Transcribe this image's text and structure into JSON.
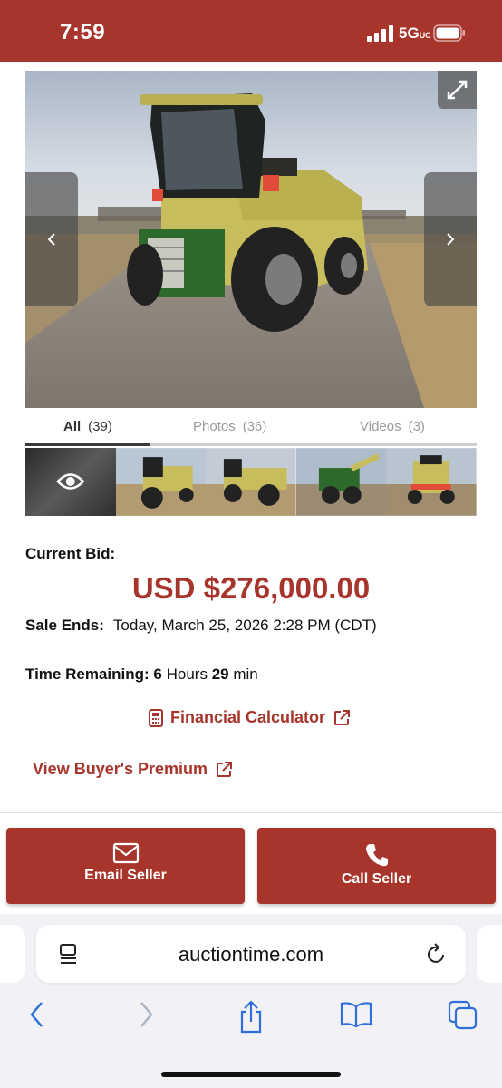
{
  "status_bar": {
    "time": "7:59",
    "network": "5G",
    "network_suffix": "UC"
  },
  "gallery": {
    "main_image": "forage-harvester-photo",
    "tabs": [
      {
        "label": "All",
        "count": "(39)",
        "active": true
      },
      {
        "label": "Photos",
        "count": "(36)",
        "active": false
      },
      {
        "label": "Videos",
        "count": "(3)",
        "active": false
      }
    ],
    "thumbnails": [
      "video-thumbnail",
      "harvester-front-view",
      "harvester-side-view",
      "harvester-spout-view",
      "harvester-rear-view"
    ]
  },
  "listing": {
    "current_bid_label": "Current Bid:",
    "bid_amount": "USD $276,000.00",
    "sale_ends_label": "Sale Ends:",
    "sale_ends_value": "Today, March 25, 2026 2:28 PM (CDT)",
    "time_remaining_label": "Time Remaining:",
    "hours_value": "6",
    "hours_unit": "Hours",
    "minutes_value": "29",
    "minutes_unit": "min",
    "financial_calculator": "Financial Calculator",
    "buyers_premium": "View Buyer's Premium"
  },
  "actions": {
    "email_label": "Email Seller",
    "call_label": "Call Seller"
  },
  "browser": {
    "url": "auctiontime.com"
  },
  "colors": {
    "brand": "#a8352c",
    "browser_accent": "#2f6fdb"
  }
}
